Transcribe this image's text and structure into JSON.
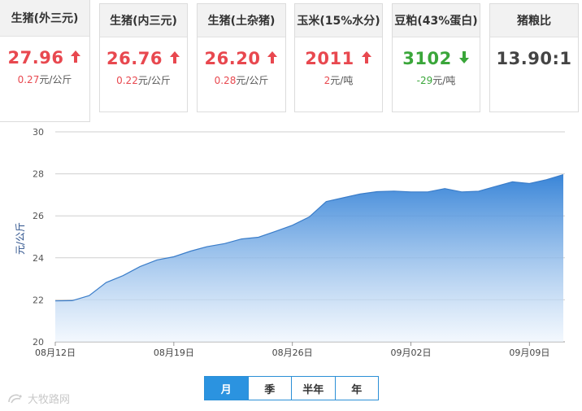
{
  "cards": [
    {
      "title": "生猪(外三元)",
      "price": "27.96",
      "dir": "up",
      "change": "0.27",
      "unit": "元/公斤"
    },
    {
      "title": "生猪(内三元)",
      "price": "26.76",
      "dir": "up",
      "change": "0.22",
      "unit": "元/公斤"
    },
    {
      "title": "生猪(土杂猪)",
      "price": "26.20",
      "dir": "up",
      "change": "0.28",
      "unit": "元/公斤"
    },
    {
      "title": "玉米(15%水分)",
      "price": "2011",
      "dir": "up",
      "change": "2",
      "unit": "元/吨"
    },
    {
      "title": "豆粕(43%蛋白)",
      "price": "3102",
      "dir": "down",
      "change": "-29",
      "unit": "元/吨"
    },
    {
      "title": "猪粮比",
      "price": "13.90:1",
      "dir": "none",
      "change": "",
      "unit": ""
    }
  ],
  "colors": {
    "up": "#e8484f",
    "down": "#3aa63a",
    "area_top": "#2f7fd6",
    "area_bottom": "#eef5fd",
    "tab_active": "#2b93e0"
  },
  "chart_data": {
    "type": "area",
    "ylabel": "元/公斤",
    "ylim": [
      20,
      30
    ],
    "yticks": [
      20,
      22,
      24,
      26,
      28,
      30
    ],
    "x_tick_labels": [
      "08月12日",
      "08月19日",
      "08月26日",
      "09月02日",
      "09月09日"
    ],
    "x_tick_index": [
      0,
      7,
      14,
      21,
      28
    ],
    "grid": true,
    "dates": [
      "08-12",
      "08-13",
      "08-14",
      "08-15",
      "08-16",
      "08-17",
      "08-18",
      "08-19",
      "08-20",
      "08-21",
      "08-22",
      "08-23",
      "08-24",
      "08-25",
      "08-26",
      "08-27",
      "08-28",
      "08-29",
      "08-30",
      "08-31",
      "09-01",
      "09-02",
      "09-03",
      "09-04",
      "09-05",
      "09-06",
      "09-07",
      "09-08",
      "09-09",
      "09-10",
      "09-11"
    ],
    "values": [
      21.95,
      21.96,
      22.2,
      22.82,
      23.15,
      23.58,
      23.9,
      24.05,
      24.32,
      24.54,
      24.68,
      24.9,
      24.98,
      25.26,
      25.55,
      25.95,
      26.68,
      26.86,
      27.04,
      27.15,
      27.18,
      27.14,
      27.14,
      27.3,
      27.14,
      27.17,
      27.4,
      27.62,
      27.54,
      27.72,
      27.96
    ]
  },
  "tabs": [
    {
      "label": "月",
      "active": true
    },
    {
      "label": "季",
      "active": false
    },
    {
      "label": "半年",
      "active": false
    },
    {
      "label": "年",
      "active": false
    }
  ],
  "watermark": "大牧路网"
}
